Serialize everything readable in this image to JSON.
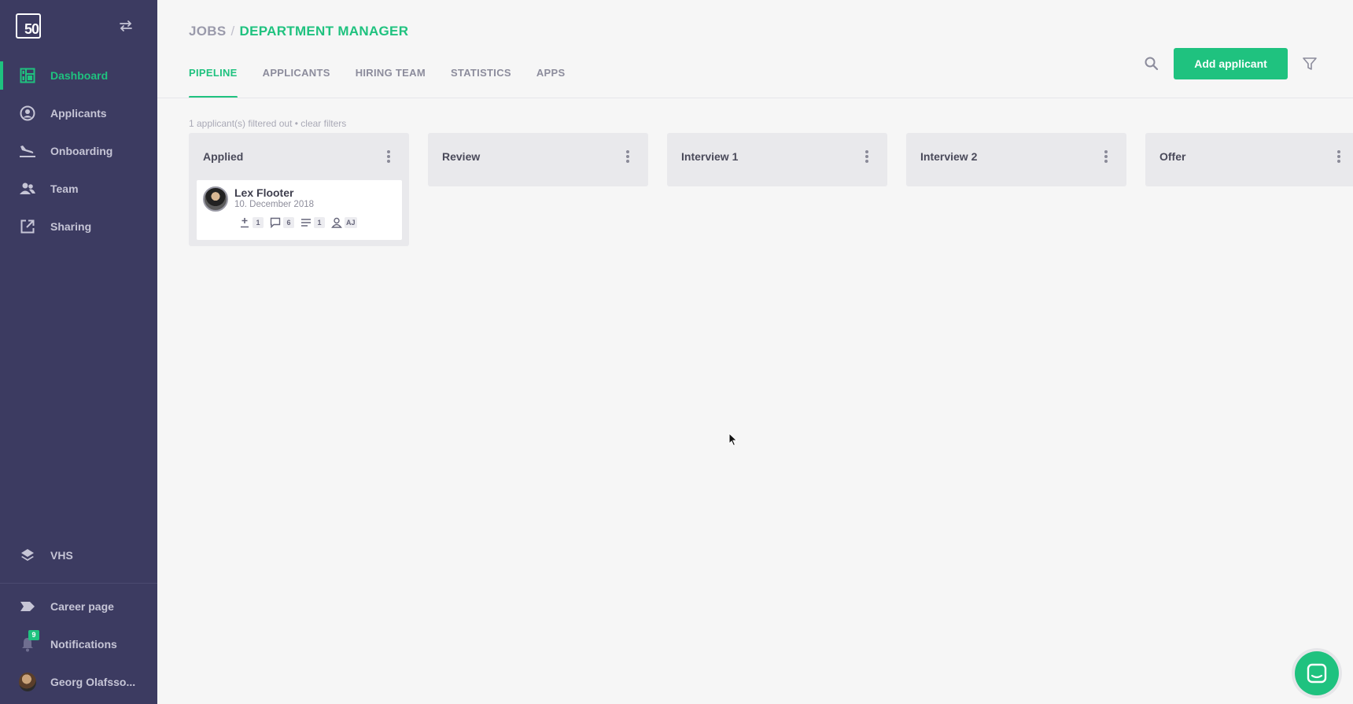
{
  "sidebar": {
    "logo_text": "50",
    "items": [
      {
        "label": "Dashboard",
        "icon": "dashboard-icon",
        "active": true
      },
      {
        "label": "Applicants",
        "icon": "user-circle-icon"
      },
      {
        "label": "Onboarding",
        "icon": "plane-landing-icon"
      },
      {
        "label": "Team",
        "icon": "team-icon"
      },
      {
        "label": "Sharing",
        "icon": "share-external-icon"
      }
    ],
    "vhs": {
      "label": "VHS",
      "icon": "layers-icon"
    },
    "career_page": {
      "label": "Career page",
      "icon": "tag-icon"
    },
    "notifications": {
      "label": "Notifications",
      "icon": "bell-icon",
      "count": "9"
    },
    "user": {
      "label": "Georg Olafsso..."
    }
  },
  "header": {
    "breadcrumb_root": "JOBS",
    "breadcrumb_sep": "/",
    "breadcrumb_current": "DEPARTMENT MANAGER",
    "tabs": [
      "PIPELINE",
      "APPLICANTS",
      "HIRING TEAM",
      "STATISTICS",
      "APPS"
    ],
    "active_tab": "PIPELINE",
    "add_button": "Add applicant"
  },
  "filter_note": "1 applicant(s) filtered out • clear filters",
  "board": {
    "columns": [
      {
        "title": "Applied"
      },
      {
        "title": "Review"
      },
      {
        "title": "Interview 1"
      },
      {
        "title": "Interview 2"
      },
      {
        "title": "Offer"
      }
    ],
    "card": {
      "name": "Lex Flooter",
      "date": "10. December 2018",
      "votes": "1",
      "comments": "6",
      "notes": "1",
      "assignee": "AJ"
    }
  },
  "colors": {
    "accent": "#1fc27f",
    "sidebar": "#3c3b61",
    "background": "#f6f6f6"
  }
}
